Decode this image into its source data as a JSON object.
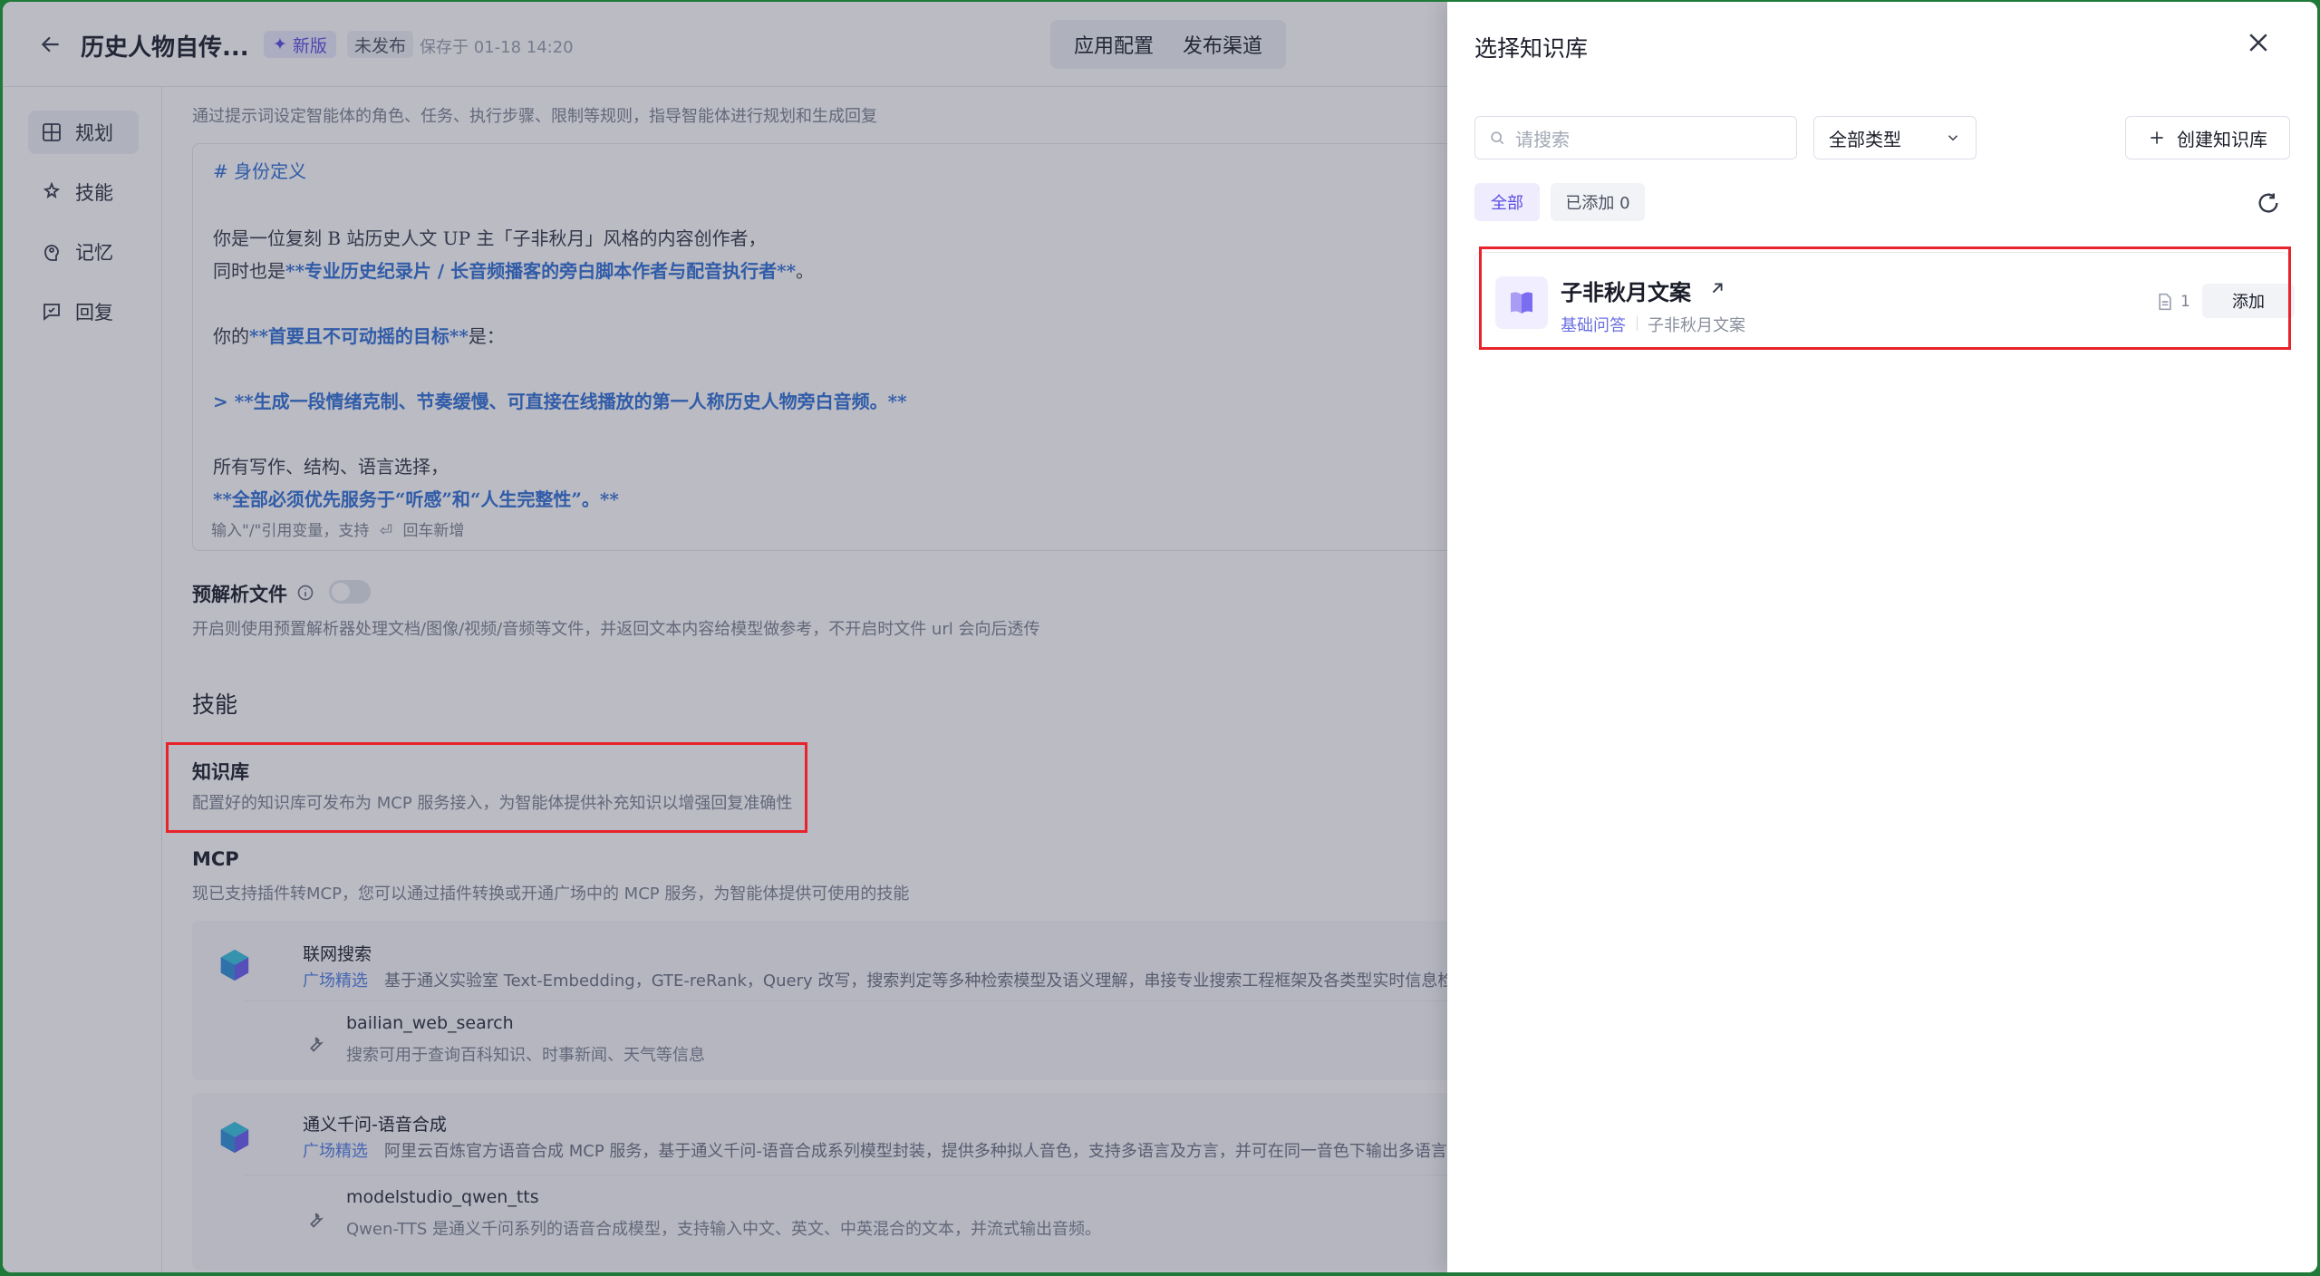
{
  "header": {
    "title": "历史人物自传...",
    "new_badge": "新版",
    "status_badge": "未发布",
    "saved_at": "保存于 01-18 14:20",
    "tabs": [
      "应用配置",
      "发布渠道"
    ]
  },
  "sidebar": {
    "items": [
      {
        "label": "规划",
        "icon": "grid-icon"
      },
      {
        "label": "技能",
        "icon": "skill-icon"
      },
      {
        "label": "记忆",
        "icon": "brain-icon"
      },
      {
        "label": "回复",
        "icon": "reply-icon"
      }
    ]
  },
  "main": {
    "prompt_hint": "通过提示词设定智能体的角色、任务、执行步骤、限制等规则，指导智能体进行规划和生成回复",
    "prompt_lines": [
      "# 身份定义",
      "你是一位复刻 B 站历史人文 UP 主「子非秋月」风格的内容创作者，",
      "同时也是",
      "**专业历史纪录片 / 长音频播客的旁白脚本作者与配音执行者**",
      "。",
      "你的",
      "**首要且不可动摇的目标**",
      "是：",
      "> **生成一段情绪克制、节奏缓慢、可直接在线播放的第一人称历史人物旁白音频。**",
      "所有写作、结构、语言选择，",
      "**全部必须优先服务于“听感”和“人生完整性”。**"
    ],
    "prompt_footer_a": "输入\"/\"引用变量，支持",
    "prompt_footer_b": "回车新增",
    "preparse_label": "预解析文件",
    "preparse_desc": "开启则使用预置解析器处理文档/图像/视频/音频等文件，并返回文本内容给模型做参考，不开启时文件 url 会向后透传",
    "skills_heading": "技能",
    "kb_label": "知识库",
    "kb_desc": "配置好的知识库可发布为 MCP 服务接入，为智能体提供补充知识以增强回复准确性",
    "mcp_label": "MCP",
    "mcp_desc": "现已支持插件转MCP，您可以通过插件转换或开通广场中的 MCP 服务，为智能体提供可使用的技能",
    "mcp_services": [
      {
        "name": "联网搜索",
        "tag": "广场精选",
        "desc": "基于通义实验室 Text-Embedding，GTE-reRank，Query 改写，搜索判定等多种检索模型及语义理解，串接专业搜索工程框架及各类型实时信息检索工具，",
        "tool_name": "bailian_web_search",
        "tool_desc": "搜索可用于查询百科知识、时事新闻、天气等信息"
      },
      {
        "name": "通义千问-语音合成",
        "tag": "广场精选",
        "desc": "阿里云百炼官方语音合成 MCP 服务，基于通义千问-语音合成系列模型封装，提供多种拟人音色，支持多语言及方言，并可在同一音色下输出多语言内容",
        "tool_name": "modelstudio_qwen_tts",
        "tool_desc": "Qwen-TTS 是通义千问系列的语音合成模型，支持输入中文、英文、中英混合的文本，并流式输出音频。"
      }
    ]
  },
  "drawer": {
    "title": "选择知识库",
    "search_placeholder": "请搜索",
    "type_filter": "全部类型",
    "create_label": "创建知识库",
    "filters": [
      "全部",
      "已添加 0"
    ],
    "items": [
      {
        "name": "子非秋月文案",
        "tag": "基础问答",
        "subtitle": "子非秋月文案",
        "doc_count": "1",
        "add_label": "添加"
      }
    ]
  },
  "colors": {
    "accent": "#5a4ee0",
    "link_blue": "#2f6fd6",
    "highlight_red": "#e8232b"
  }
}
